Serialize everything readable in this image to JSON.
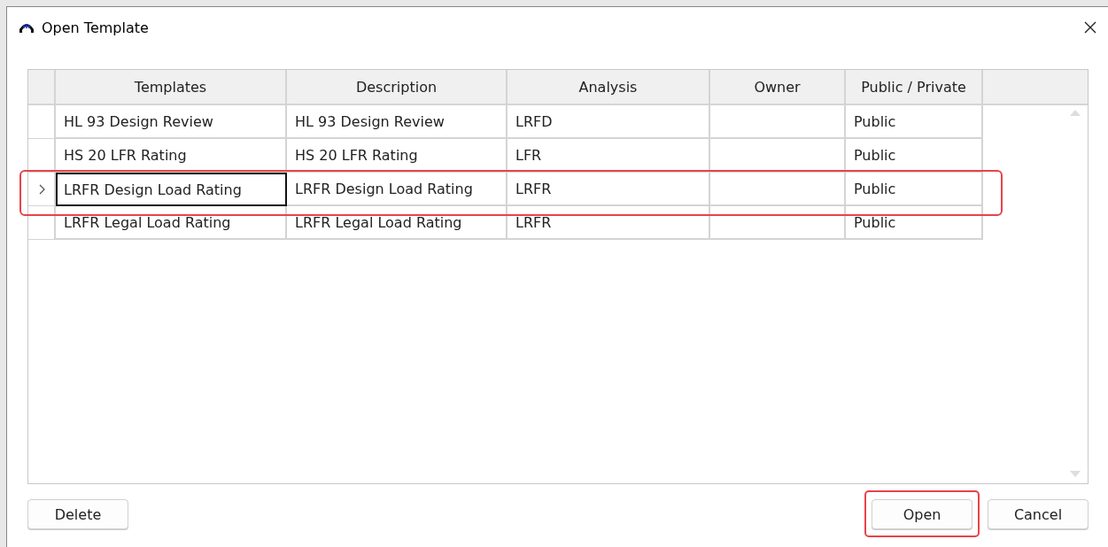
{
  "window": {
    "title": "Open Template"
  },
  "table": {
    "columns": [
      "Templates",
      "Description",
      "Analysis",
      "Owner",
      "Public / Private"
    ],
    "rows": [
      {
        "cells": [
          "HL 93 Design Review",
          "HL 93 Design Review",
          "LRFD",
          "",
          "Public"
        ],
        "selected": false,
        "highlighted": false
      },
      {
        "cells": [
          "HS 20 LFR Rating",
          "HS 20 LFR Rating",
          "LFR",
          "",
          "Public"
        ],
        "selected": false,
        "highlighted": false
      },
      {
        "cells": [
          "LRFR Design Load Rating",
          "LRFR Design Load Rating",
          "LRFR",
          "",
          "Public"
        ],
        "selected": true,
        "highlighted": true
      },
      {
        "cells": [
          "LRFR Legal Load Rating",
          "LRFR Legal Load Rating",
          "LRFR",
          "",
          "Public"
        ],
        "selected": false,
        "highlighted": false
      }
    ]
  },
  "buttons": [
    {
      "label": "Delete",
      "kind": "left",
      "highlighted": false
    },
    {
      "label": "Open",
      "kind": "right",
      "highlighted": true
    },
    {
      "label": "Cancel",
      "kind": "right",
      "highlighted": false
    }
  ]
}
